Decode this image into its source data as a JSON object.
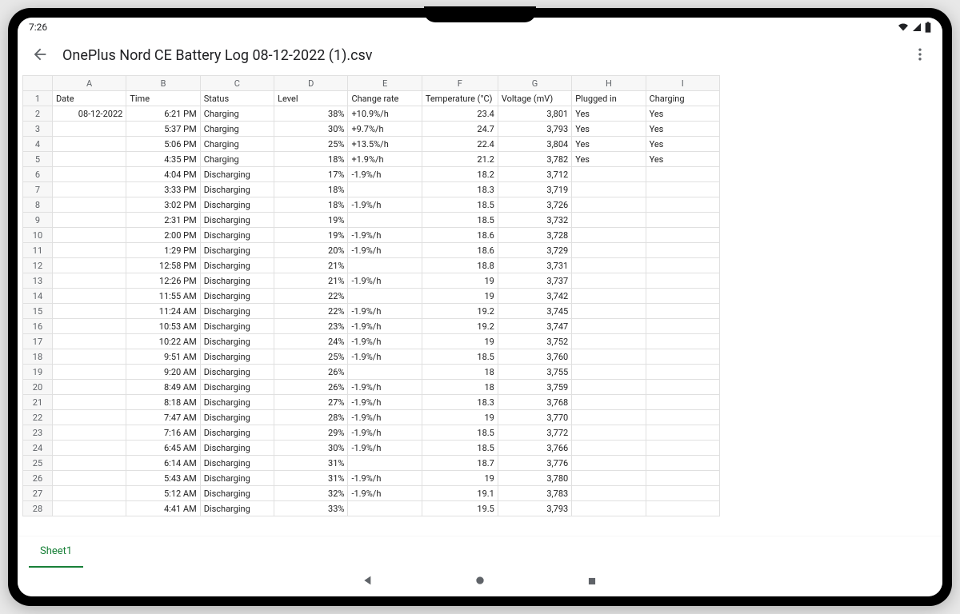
{
  "status": {
    "time": "7:26"
  },
  "header": {
    "title": "OnePlus Nord CE Battery Log 08-12-2022 (1).csv"
  },
  "columns": [
    "",
    "A",
    "B",
    "C",
    "D",
    "E",
    "F",
    "G",
    "H",
    "I"
  ],
  "headers": {
    "row_num": "1",
    "A": "Date",
    "B": "Time",
    "C": "Status",
    "D": "Level",
    "E": "Change rate",
    "F": "Temperature (°C)",
    "G": "Voltage (mV)",
    "H": "Plugged in",
    "I": "Charging"
  },
  "rows": [
    {
      "n": "2",
      "A": "08-12-2022",
      "B": "6:21 PM",
      "C": "Charging",
      "D": "38%",
      "E": "+10.9%/h",
      "F": "23.4",
      "G": "3,801",
      "H": "Yes",
      "I": "Yes"
    },
    {
      "n": "3",
      "A": "",
      "B": "5:37 PM",
      "C": "Charging",
      "D": "30%",
      "E": "+9.7%/h",
      "F": "24.7",
      "G": "3,793",
      "H": "Yes",
      "I": "Yes"
    },
    {
      "n": "4",
      "A": "",
      "B": "5:06 PM",
      "C": "Charging",
      "D": "25%",
      "E": "+13.5%/h",
      "F": "22.4",
      "G": "3,804",
      "H": "Yes",
      "I": "Yes"
    },
    {
      "n": "5",
      "A": "",
      "B": "4:35 PM",
      "C": "Charging",
      "D": "18%",
      "E": "+1.9%/h",
      "F": "21.2",
      "G": "3,782",
      "H": "Yes",
      "I": "Yes"
    },
    {
      "n": "6",
      "A": "",
      "B": "4:04 PM",
      "C": "Discharging",
      "D": "17%",
      "E": "-1.9%/h",
      "F": "18.2",
      "G": "3,712",
      "H": "",
      "I": ""
    },
    {
      "n": "7",
      "A": "",
      "B": "3:33 PM",
      "C": "Discharging",
      "D": "18%",
      "E": "",
      "F": "18.3",
      "G": "3,719",
      "H": "",
      "I": ""
    },
    {
      "n": "8",
      "A": "",
      "B": "3:02 PM",
      "C": "Discharging",
      "D": "18%",
      "E": "-1.9%/h",
      "F": "18.5",
      "G": "3,726",
      "H": "",
      "I": ""
    },
    {
      "n": "9",
      "A": "",
      "B": "2:31 PM",
      "C": "Discharging",
      "D": "19%",
      "E": "",
      "F": "18.5",
      "G": "3,732",
      "H": "",
      "I": ""
    },
    {
      "n": "10",
      "A": "",
      "B": "2:00 PM",
      "C": "Discharging",
      "D": "19%",
      "E": "-1.9%/h",
      "F": "18.6",
      "G": "3,728",
      "H": "",
      "I": ""
    },
    {
      "n": "11",
      "A": "",
      "B": "1:29 PM",
      "C": "Discharging",
      "D": "20%",
      "E": "-1.9%/h",
      "F": "18.6",
      "G": "3,729",
      "H": "",
      "I": ""
    },
    {
      "n": "12",
      "A": "",
      "B": "12:58 PM",
      "C": "Discharging",
      "D": "21%",
      "E": "",
      "F": "18.8",
      "G": "3,731",
      "H": "",
      "I": ""
    },
    {
      "n": "13",
      "A": "",
      "B": "12:26 PM",
      "C": "Discharging",
      "D": "21%",
      "E": "-1.9%/h",
      "F": "19",
      "G": "3,737",
      "H": "",
      "I": ""
    },
    {
      "n": "14",
      "A": "",
      "B": "11:55 AM",
      "C": "Discharging",
      "D": "22%",
      "E": "",
      "F": "19",
      "G": "3,742",
      "H": "",
      "I": ""
    },
    {
      "n": "15",
      "A": "",
      "B": "11:24 AM",
      "C": "Discharging",
      "D": "22%",
      "E": "-1.9%/h",
      "F": "19.2",
      "G": "3,745",
      "H": "",
      "I": ""
    },
    {
      "n": "16",
      "A": "",
      "B": "10:53 AM",
      "C": "Discharging",
      "D": "23%",
      "E": "-1.9%/h",
      "F": "19.2",
      "G": "3,747",
      "H": "",
      "I": ""
    },
    {
      "n": "17",
      "A": "",
      "B": "10:22 AM",
      "C": "Discharging",
      "D": "24%",
      "E": "-1.9%/h",
      "F": "19",
      "G": "3,752",
      "H": "",
      "I": ""
    },
    {
      "n": "18",
      "A": "",
      "B": "9:51 AM",
      "C": "Discharging",
      "D": "25%",
      "E": "-1.9%/h",
      "F": "18.5",
      "G": "3,760",
      "H": "",
      "I": ""
    },
    {
      "n": "19",
      "A": "",
      "B": "9:20 AM",
      "C": "Discharging",
      "D": "26%",
      "E": "",
      "F": "18",
      "G": "3,755",
      "H": "",
      "I": ""
    },
    {
      "n": "20",
      "A": "",
      "B": "8:49 AM",
      "C": "Discharging",
      "D": "26%",
      "E": "-1.9%/h",
      "F": "18",
      "G": "3,759",
      "H": "",
      "I": ""
    },
    {
      "n": "21",
      "A": "",
      "B": "8:18 AM",
      "C": "Discharging",
      "D": "27%",
      "E": "-1.9%/h",
      "F": "18.3",
      "G": "3,768",
      "H": "",
      "I": ""
    },
    {
      "n": "22",
      "A": "",
      "B": "7:47 AM",
      "C": "Discharging",
      "D": "28%",
      "E": "-1.9%/h",
      "F": "19",
      "G": "3,770",
      "H": "",
      "I": ""
    },
    {
      "n": "23",
      "A": "",
      "B": "7:16 AM",
      "C": "Discharging",
      "D": "29%",
      "E": "-1.9%/h",
      "F": "18.5",
      "G": "3,772",
      "H": "",
      "I": ""
    },
    {
      "n": "24",
      "A": "",
      "B": "6:45 AM",
      "C": "Discharging",
      "D": "30%",
      "E": "-1.9%/h",
      "F": "18.5",
      "G": "3,766",
      "H": "",
      "I": ""
    },
    {
      "n": "25",
      "A": "",
      "B": "6:14 AM",
      "C": "Discharging",
      "D": "31%",
      "E": "",
      "F": "18.7",
      "G": "3,776",
      "H": "",
      "I": ""
    },
    {
      "n": "26",
      "A": "",
      "B": "5:43 AM",
      "C": "Discharging",
      "D": "31%",
      "E": "-1.9%/h",
      "F": "19",
      "G": "3,780",
      "H": "",
      "I": ""
    },
    {
      "n": "27",
      "A": "",
      "B": "5:12 AM",
      "C": "Discharging",
      "D": "32%",
      "E": "-1.9%/h",
      "F": "19.1",
      "G": "3,783",
      "H": "",
      "I": ""
    },
    {
      "n": "28",
      "A": "",
      "B": "4:41 AM",
      "C": "Discharging",
      "D": "33%",
      "E": "",
      "F": "19.5",
      "G": "3,793",
      "H": "",
      "I": ""
    }
  ],
  "tabs": {
    "active": "Sheet1"
  }
}
